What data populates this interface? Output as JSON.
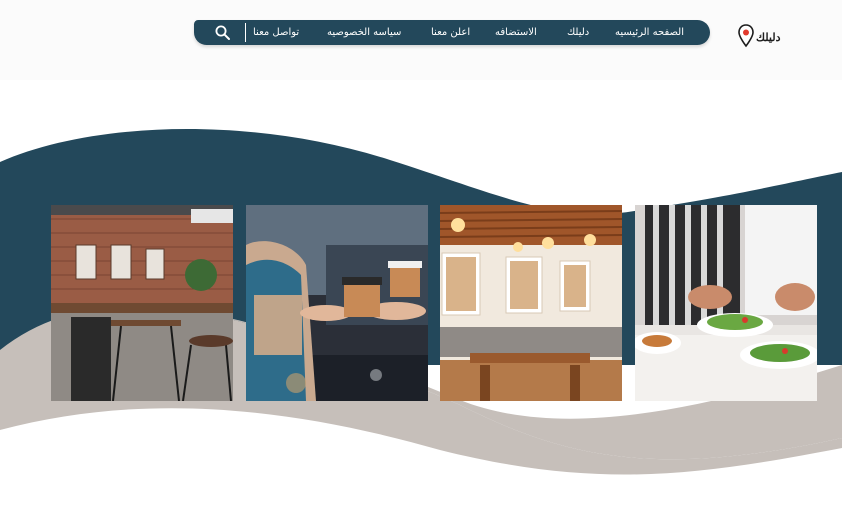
{
  "brand": {
    "logo_text": "دليلك"
  },
  "nav": {
    "items": [
      {
        "label": "الصفحه الرئيسيه",
        "name": "nav-item-home"
      },
      {
        "label": "دليلك",
        "name": "nav-item-guide"
      },
      {
        "label": "الاستضافه",
        "name": "nav-item-hosting"
      },
      {
        "label": "اعلن معنا",
        "name": "nav-item-advertise"
      },
      {
        "label": "سياسه الخصوصيه",
        "name": "nav-item-privacy"
      },
      {
        "label": "تواصل معنا",
        "name": "nav-item-contact"
      }
    ],
    "search_icon": "search-icon"
  },
  "colors": {
    "navy": "#23485b",
    "taupe": "#c6bfba",
    "header_bg": "#fbfbfb",
    "nav_text": "#ffffff"
  },
  "gallery": {
    "images": [
      {
        "name": "photo-chef-plating",
        "subject": "chef plating salads"
      },
      {
        "name": "photo-restaurant-interior",
        "subject": "restaurant dining room with pendant lights"
      },
      {
        "name": "photo-coffee-handoff",
        "subject": "barista handing coffee cup"
      },
      {
        "name": "photo-industrial-cafe",
        "subject": "industrial brick cafe"
      }
    ]
  }
}
